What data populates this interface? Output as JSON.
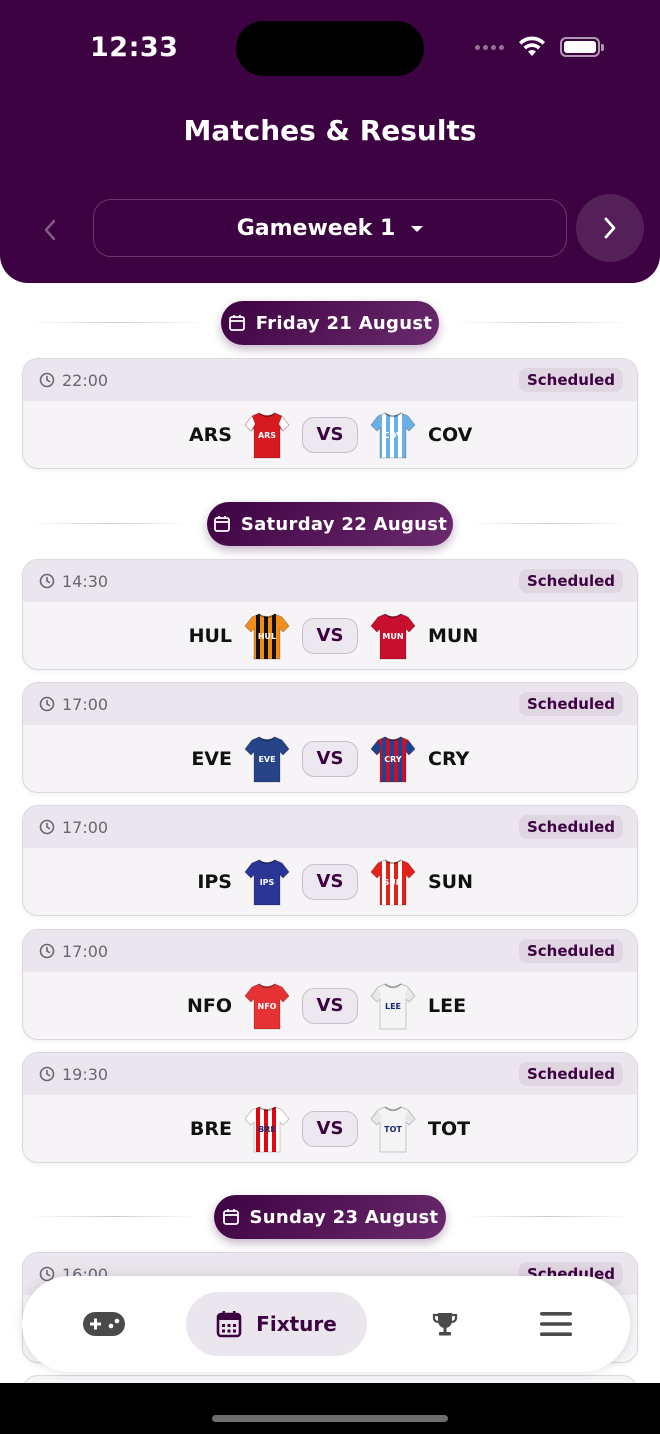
{
  "status_bar": {
    "time": "12:33"
  },
  "header": {
    "title": "Matches & Results"
  },
  "gameweek": {
    "label": "Gameweek 1"
  },
  "days": [
    {
      "label": "Friday 21 August",
      "matches": [
        {
          "time": "22:00",
          "status": "Scheduled",
          "home": "ARS",
          "away": "COV"
        }
      ]
    },
    {
      "label": "Saturday 22 August",
      "matches": [
        {
          "time": "14:30",
          "status": "Scheduled",
          "home": "HUL",
          "away": "MUN"
        },
        {
          "time": "17:00",
          "status": "Scheduled",
          "home": "EVE",
          "away": "CRY"
        },
        {
          "time": "17:00",
          "status": "Scheduled",
          "home": "IPS",
          "away": "SUN"
        },
        {
          "time": "17:00",
          "status": "Scheduled",
          "home": "NFO",
          "away": "LEE"
        },
        {
          "time": "19:30",
          "status": "Scheduled",
          "home": "BRE",
          "away": "TOT"
        }
      ]
    },
    {
      "label": "Sunday 23 August",
      "matches": [
        {
          "time": "16:00",
          "status": "Scheduled"
        }
      ]
    }
  ],
  "vs_label": "VS",
  "nav": {
    "items": [
      {
        "name": "games",
        "icon": "gamepad-icon"
      },
      {
        "name": "fixture",
        "label": "Fixture",
        "icon": "calendar-icon"
      },
      {
        "name": "trophy",
        "icon": "trophy-icon"
      },
      {
        "name": "menu",
        "icon": "menu-icon"
      }
    ]
  },
  "colors": {
    "brand": "#3d0241",
    "card_bg": "#f6f4f7",
    "card_header_bg": "#ebe6ed",
    "badge_bg": "#e0d6e2"
  },
  "shirts": {
    "ARS": {
      "color": "#d71920",
      "sleeve": "#ffffff",
      "stripes": ""
    },
    "COV": {
      "color": "#6ab0e6",
      "sleeve": "#6ab0e6",
      "stripes": "#ffffff"
    },
    "HUL": {
      "color": "#f28c1a",
      "sleeve": "#f28c1a",
      "stripes": "#111111"
    },
    "MUN": {
      "color": "#c8102e",
      "sleeve": "#c8102e",
      "stripes": ""
    },
    "EVE": {
      "color": "#274488",
      "sleeve": "#274488",
      "stripes": ""
    },
    "CRY": {
      "color": "#c8102e",
      "sleeve": "#1b458f",
      "stripes": "#1b458f"
    },
    "IPS": {
      "color": "#2a3596",
      "sleeve": "#2a3596",
      "stripes": ""
    },
    "SUN": {
      "color": "#e32219",
      "sleeve": "#e32219",
      "stripes": "#ffffff"
    },
    "NFO": {
      "color": "#e53233",
      "sleeve": "#e53233",
      "stripes": ""
    },
    "LEE": {
      "color": "#f4f4f4",
      "sleeve": "#e8e8e8",
      "stripes": ""
    },
    "BRE": {
      "color": "#ffffff",
      "sleeve": "#ffffff",
      "stripes": "#e30613"
    },
    "TOT": {
      "color": "#f4f4f4",
      "sleeve": "#e8e8e8",
      "stripes": ""
    }
  }
}
